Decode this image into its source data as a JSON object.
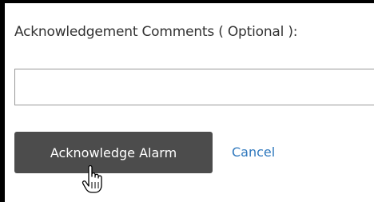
{
  "form": {
    "comments_label": "Acknowledgement Comments ( Optional ):",
    "comments_value": "",
    "comments_placeholder": "",
    "acknowledge_label": "Acknowledge Alarm",
    "cancel_label": "Cancel"
  },
  "colors": {
    "button_bg": "#4c4c4c",
    "link": "#2f78bd",
    "frame": "#000000"
  },
  "icons": {
    "cursor": "hand-pointer-icon"
  }
}
